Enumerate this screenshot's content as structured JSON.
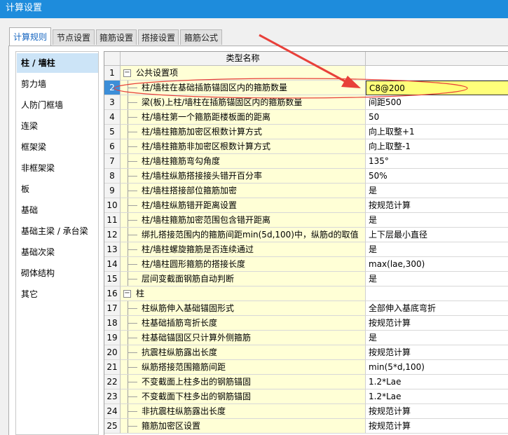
{
  "window": {
    "title": "计算设置"
  },
  "tabs": [
    {
      "label": "计算规则",
      "active": true
    },
    {
      "label": "节点设置",
      "active": false
    },
    {
      "label": "箍筋设置",
      "active": false
    },
    {
      "label": "搭接设置",
      "active": false
    },
    {
      "label": "箍筋公式",
      "active": false
    }
  ],
  "sidebar": {
    "items": [
      {
        "label": "柱 / 墙柱",
        "active": true
      },
      {
        "label": "剪力墙"
      },
      {
        "label": "人防门框墙"
      },
      {
        "label": "连梁"
      },
      {
        "label": "框架梁"
      },
      {
        "label": "非框架梁"
      },
      {
        "label": "板"
      },
      {
        "label": "基础"
      },
      {
        "label": "基础主梁 / 承台梁"
      },
      {
        "label": "基础次梁"
      },
      {
        "label": "砌体结构"
      },
      {
        "label": "其它"
      }
    ]
  },
  "grid": {
    "header": {
      "name_col": "类型名称"
    },
    "rows": [
      {
        "num": "1",
        "name": "公共设置项",
        "value": "",
        "category": true,
        "expander": "−"
      },
      {
        "num": "2",
        "name": "柱/墙柱在基础插筋锚固区内的箍筋数量",
        "value": "C8@200",
        "selected": true
      },
      {
        "num": "3",
        "name": "梁(板)上柱/墙柱在插筋锚固区内的箍筋数量",
        "value": "间距500"
      },
      {
        "num": "4",
        "name": "柱/墙柱第一个箍筋距楼板面的距离",
        "value": "50"
      },
      {
        "num": "5",
        "name": "柱/墙柱箍筋加密区根数计算方式",
        "value": "向上取整+1"
      },
      {
        "num": "6",
        "name": "柱/墙柱箍筋非加密区根数计算方式",
        "value": "向上取整-1"
      },
      {
        "num": "7",
        "name": "柱/墙柱箍筋弯勾角度",
        "value": "135°"
      },
      {
        "num": "8",
        "name": "柱/墙柱纵筋搭接接头错开百分率",
        "value": "50%"
      },
      {
        "num": "9",
        "name": "柱/墙柱搭接部位箍筋加密",
        "value": "是"
      },
      {
        "num": "10",
        "name": "柱/墙柱纵筋错开距离设置",
        "value": "按规范计算"
      },
      {
        "num": "11",
        "name": "柱/墙柱箍筋加密范围包含错开距离",
        "value": "是"
      },
      {
        "num": "12",
        "name": "绑扎搭接范围内的箍筋间距min(5d,100)中，纵筋d的取值",
        "value": "上下层最小直径"
      },
      {
        "num": "13",
        "name": "柱/墙柱螺旋箍筋是否连续通过",
        "value": "是"
      },
      {
        "num": "14",
        "name": "柱/墙柱圆形箍筋的搭接长度",
        "value": "max(lae,300)"
      },
      {
        "num": "15",
        "name": "层间变截面钢筋自动判断",
        "value": "是"
      },
      {
        "num": "16",
        "name": "柱",
        "value": "",
        "category": true,
        "expander": "−"
      },
      {
        "num": "17",
        "name": "柱纵筋伸入基础锚固形式",
        "value": "全部伸入基底弯折"
      },
      {
        "num": "18",
        "name": "柱基础插筋弯折长度",
        "value": "按规范计算"
      },
      {
        "num": "19",
        "name": "柱基础锚固区只计算外侧箍筋",
        "value": "是"
      },
      {
        "num": "20",
        "name": "抗震柱纵筋露出长度",
        "value": "按规范计算"
      },
      {
        "num": "21",
        "name": "纵筋搭接范围箍筋间距",
        "value": "min(5*d,100)"
      },
      {
        "num": "22",
        "name": "不变截面上柱多出的钢筋锚固",
        "value": "1.2*Lae"
      },
      {
        "num": "23",
        "name": "不变截面下柱多出的钢筋锚固",
        "value": "1.2*Lae"
      },
      {
        "num": "24",
        "name": "非抗震柱纵筋露出长度",
        "value": "按规范计算"
      },
      {
        "num": "25",
        "name": "箍筋加密区设置",
        "value": "按规范计算"
      }
    ]
  },
  "annotation": {
    "color": "#e8403a"
  }
}
